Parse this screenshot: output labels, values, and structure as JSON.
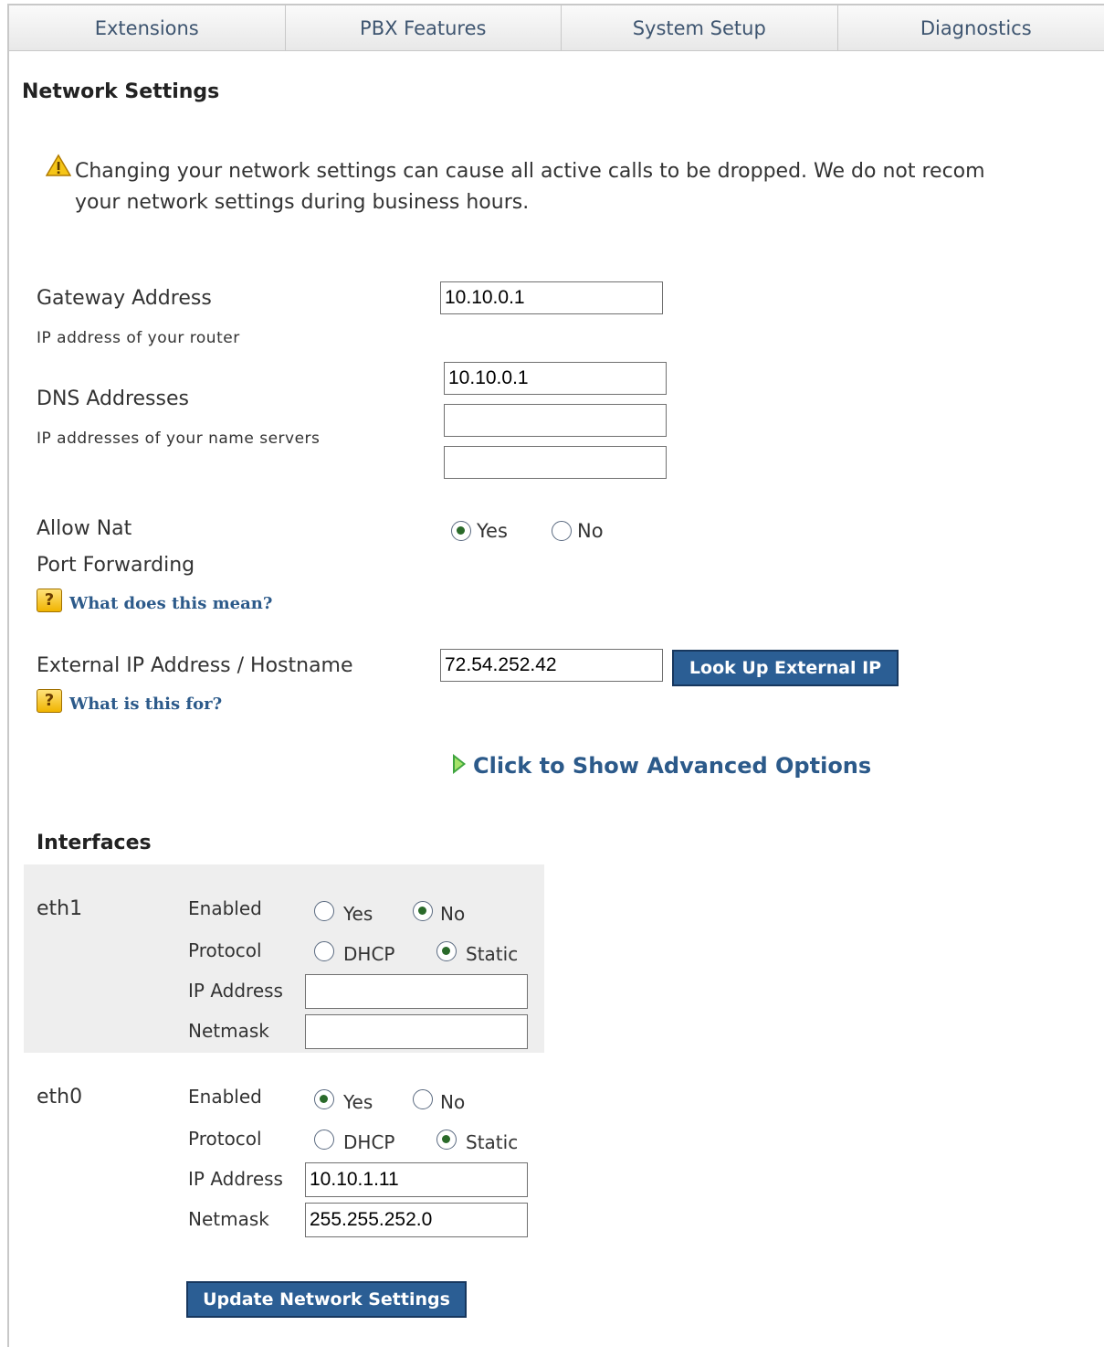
{
  "tabs": [
    "Extensions",
    "PBX Features",
    "System Setup",
    "Diagnostics"
  ],
  "page": {
    "title": "Network Settings",
    "warning_line1": "Changing your network settings can cause all active calls to be dropped. We do not recom",
    "warning_line2": "your network settings during business hours."
  },
  "gateway": {
    "label": "Gateway Address",
    "sub": "IP address of your router",
    "value": "10.10.0.1"
  },
  "dns": {
    "label": "DNS Addresses",
    "sub": "IP addresses of your name servers",
    "values": [
      "10.10.0.1",
      "",
      ""
    ]
  },
  "nat": {
    "label1": "Allow Nat",
    "label2": "Port Forwarding",
    "yes_label": "Yes",
    "no_label": "No",
    "selected": "Yes",
    "help_link": "What does this mean?"
  },
  "external_ip": {
    "label": "External IP Address / Hostname",
    "value": "72.54.252.42",
    "button": "Look Up External IP",
    "help_link": "What is this for?"
  },
  "advanced": {
    "link": "Click to Show Advanced Options"
  },
  "interfaces": {
    "title": "Interfaces",
    "labels": {
      "enabled": "Enabled",
      "protocol": "Protocol",
      "ip": "IP Address",
      "netmask": "Netmask",
      "yes": "Yes",
      "no": "No",
      "dhcp": "DHCP",
      "static": "Static"
    },
    "items": [
      {
        "name": "eth1",
        "enabled": "No",
        "protocol": "Static",
        "ip": "",
        "netmask": ""
      },
      {
        "name": "eth0",
        "enabled": "Yes",
        "protocol": "Static",
        "ip": "10.10.1.11",
        "netmask": "255.255.252.0"
      }
    ]
  },
  "submit": {
    "label": "Update Network Settings"
  },
  "icons": {
    "warning": "warning-icon",
    "help": "help-icon",
    "expand": "expand-triangle-icon"
  },
  "colors": {
    "accent": "#2b5e94",
    "link": "#2c5a8a",
    "tab_text": "#3e5570"
  }
}
